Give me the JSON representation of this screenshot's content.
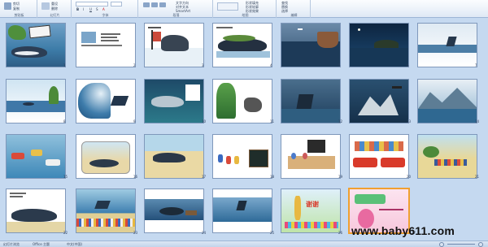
{
  "ribbon": {
    "groups": [
      {
        "label": "剪贴板",
        "items": [
          "粘贴",
          "剪切",
          "复制"
        ]
      },
      {
        "label": "幻灯片",
        "items": [
          "新建幻灯片",
          "重设",
          "删除"
        ]
      },
      {
        "label": "字体",
        "items": [
          "B",
          "I",
          "U",
          "S",
          "A"
        ]
      },
      {
        "label": "段落",
        "items": [
          "文字方向",
          "对齐文本",
          "SmartArt"
        ]
      },
      {
        "label": "绘图",
        "items": [
          "形状填充",
          "形状轮廓",
          "形状效果"
        ]
      },
      {
        "label": "编辑",
        "items": [
          "查找",
          "替换",
          "选择"
        ]
      }
    ]
  },
  "slides": [
    {
      "number": "1",
      "scene": "title-whale"
    },
    {
      "number": "2",
      "scene": "text-page"
    },
    {
      "number": "3",
      "scene": "rock-sail"
    },
    {
      "number": "4",
      "scene": "island"
    },
    {
      "number": "5",
      "scene": "storm-ship"
    },
    {
      "number": "6",
      "scene": "night-sea"
    },
    {
      "number": "7",
      "scene": "whale-fin"
    },
    {
      "number": "8",
      "scene": "palm-beach"
    },
    {
      "number": "9",
      "scene": "big-wave"
    },
    {
      "number": "10",
      "scene": "underwater"
    },
    {
      "number": "11",
      "scene": "palm-rock"
    },
    {
      "number": "12",
      "scene": "whale-tail"
    },
    {
      "number": "13",
      "scene": "iceberg-bird"
    },
    {
      "number": "14",
      "scene": "icy-mountain"
    },
    {
      "number": "15",
      "scene": "boats-whale"
    },
    {
      "number": "16",
      "scene": "beach-whale"
    },
    {
      "number": "17",
      "scene": "whale-sand"
    },
    {
      "number": "18",
      "scene": "class-board"
    },
    {
      "number": "19",
      "scene": "teacher-class"
    },
    {
      "number": "20",
      "scene": "firetruck"
    },
    {
      "number": "21",
      "scene": "beach-crowd"
    },
    {
      "number": "22",
      "scene": "whale-page"
    },
    {
      "number": "23",
      "scene": "crowd-shore"
    },
    {
      "number": "24",
      "scene": "whale-sea"
    },
    {
      "number": "25",
      "scene": "whale-tail-sea"
    },
    {
      "number": "26",
      "scene": "thanks"
    },
    {
      "number": "27",
      "scene": "contact"
    }
  ],
  "thanks_text": "谢谢",
  "status": {
    "slide_info": "幻灯片浏览",
    "theme": "Office 主题",
    "language": "中文(中国)"
  },
  "watermark": "www.baby611.com",
  "colors": {
    "accent": "#f0a030",
    "background": "#c5d9f0"
  }
}
